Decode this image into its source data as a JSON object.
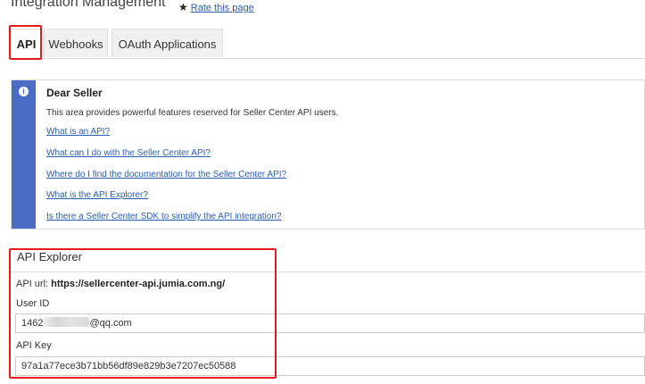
{
  "header": {
    "title": "Integration Management",
    "rate_label": "Rate this page"
  },
  "tabs": [
    {
      "label": "API",
      "active": true
    },
    {
      "label": "Webhooks",
      "active": false
    },
    {
      "label": "OAuth Applications",
      "active": false
    }
  ],
  "info": {
    "icon": "info-icon",
    "title": "Dear Seller",
    "text": "This area provides powerful features reserved for Seller Center API users.",
    "links": [
      "What is an API?",
      "What can I do with the Seller Center API?",
      "Where do I find the documentation for the Seller Center API?",
      "What is the API Explorer?",
      "Is there a Seller Center SDK to simplify the API integration?"
    ]
  },
  "explorer": {
    "title": "API Explorer",
    "api_url_label": "API url:",
    "api_url_value": "https://sellercenter-api.jumia.com.ng/",
    "user_id_label": "User ID",
    "user_id_prefix": "1462",
    "user_id_suffix": "@qq.com",
    "api_key_label": "API Key",
    "api_key_value": "97a1a77ece3b71bb56df89e829b3e7207ec50588"
  },
  "colors": {
    "accent": "#4a6cc5",
    "link": "#2a5db0",
    "highlight": "#e21b1b"
  }
}
